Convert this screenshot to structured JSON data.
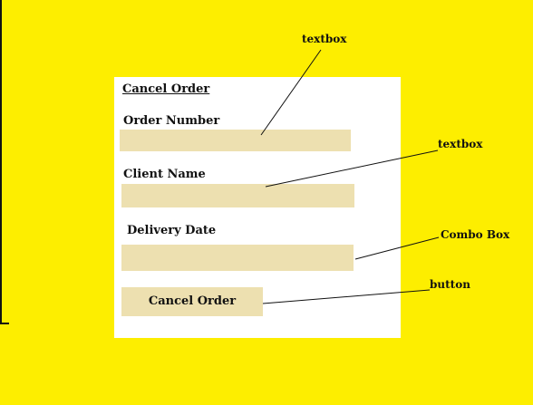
{
  "form": {
    "title": "Cancel Order",
    "order_number_label": "Order Number",
    "client_name_label": "Client Name",
    "delivery_date_label": "Delivery Date",
    "order_number_value": "",
    "client_name_value": "",
    "delivery_date_value": "",
    "cancel_button_label": "Cancel Order"
  },
  "annotations": {
    "order_number": "textbox",
    "client_name": "textbox",
    "delivery_date": "Combo Box",
    "cancel_button": "button"
  },
  "colors": {
    "background": "#fdee00",
    "panel": "#ffffff",
    "field": "#ede0b0"
  }
}
